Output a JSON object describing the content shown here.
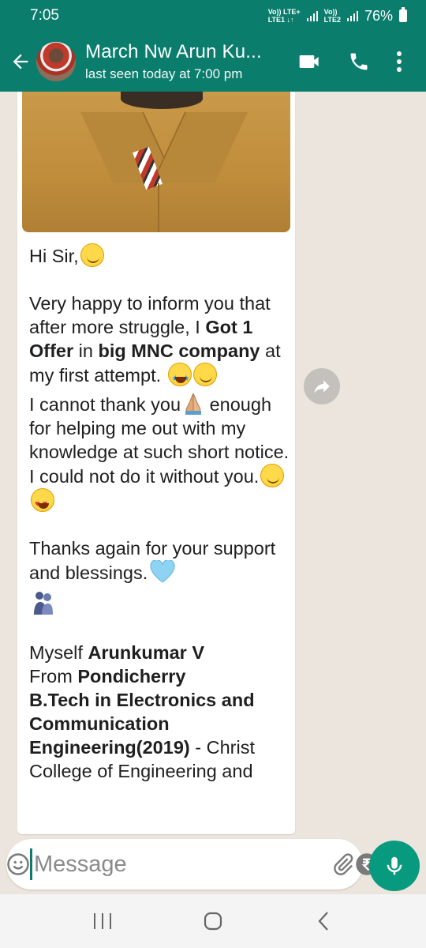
{
  "status_bar": {
    "time": "7:05",
    "sim1_label": "Vo)) LTE+",
    "sim1_sub": "LTE1 ↓↑",
    "sim2_label": "Vo))",
    "sim2_sub": "LTE2",
    "battery": "76%"
  },
  "chat_header": {
    "contact_name": "March Nw Arun Ku...",
    "last_seen": "last seen today at 7:00 pm"
  },
  "message": {
    "greeting": "Hi Sir,",
    "p1_a": "Very happy to inform you that after more struggle, I ",
    "p1_b": "Got 1 Offer",
    "p1_c": " in ",
    "p1_d": "big MNC company",
    "p1_e": " at my first attempt.",
    "p2_a": "I cannot thank you",
    "p2_b": " enough for helping me out with my knowledge at such short notice. I could not do it without you.",
    "p3": "Thanks again for your support and blessings.",
    "p4_a": "Myself ",
    "p4_b": "Arunkumar V",
    "p5_a": "From ",
    "p5_b": "Pondicherry",
    "p6_a": "B.Tech in Electronics and Communication Engineering(2019)",
    "p6_b": " - Christ College of Engineering and"
  },
  "composer": {
    "placeholder": "Message"
  },
  "icons": {
    "back": "arrow-left-icon",
    "video": "video-camera-icon",
    "call": "phone-icon",
    "menu": "more-vert-icon",
    "forward": "forward-icon",
    "emoji": "emoji-icon",
    "attach": "paperclip-icon",
    "payment": "rupee-icon",
    "camera": "camera-icon",
    "mic": "mic-icon"
  },
  "colors": {
    "header": "#0a7d6d",
    "mic_button": "#079a7f",
    "chat_bg": "#ece5dd"
  }
}
